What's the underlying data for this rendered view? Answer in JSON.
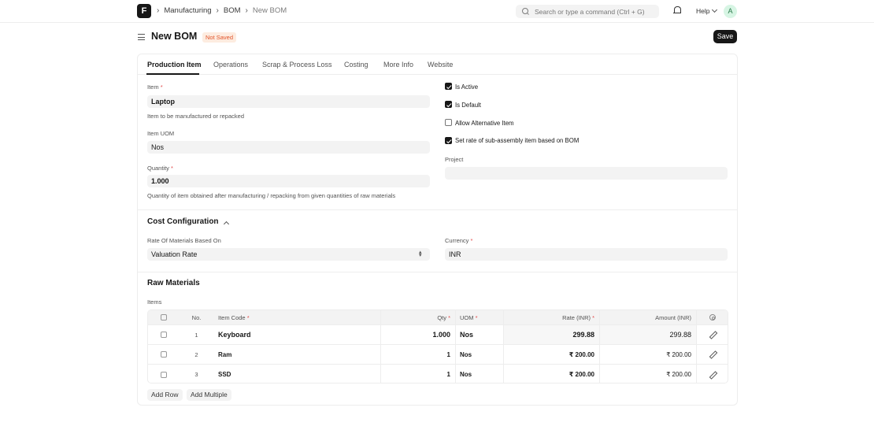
{
  "navbar": {
    "logo_letter": "F",
    "breadcrumbs": [
      "Manufacturing",
      "BOM",
      "New BOM"
    ],
    "search_placeholder": "Search or type a command (Ctrl + G)",
    "help_label": "Help",
    "avatar_letter": "A"
  },
  "header": {
    "title": "New BOM",
    "status_badge": "Not Saved",
    "save_label": "Save"
  },
  "tabs": [
    "Production Item",
    "Operations",
    "Scrap & Process Loss",
    "Costing",
    "More Info",
    "Website"
  ],
  "production": {
    "item_label": "Item",
    "item_value": "Laptop",
    "item_help": "Item to be manufactured or repacked",
    "uom_label": "Item UOM",
    "uom_value": "Nos",
    "qty_label": "Quantity",
    "qty_value": "1.000",
    "qty_help": "Quantity of item obtained after manufacturing / repacking from given quantities of raw materials",
    "checkboxes": [
      {
        "label": "Is Active",
        "checked": true
      },
      {
        "label": "Is Default",
        "checked": true
      },
      {
        "label": "Allow Alternative Item",
        "checked": false
      },
      {
        "label": "Set rate of sub-assembly item based on BOM",
        "checked": true
      }
    ],
    "project_label": "Project",
    "project_value": ""
  },
  "cost_config": {
    "title": "Cost Configuration",
    "rate_label": "Rate Of Materials Based On",
    "rate_value": "Valuation Rate",
    "currency_label": "Currency",
    "currency_value": "INR"
  },
  "raw_materials": {
    "title": "Raw Materials",
    "items_label": "Items",
    "columns": {
      "no": "No.",
      "item_code": "Item Code",
      "qty": "Qty",
      "uom": "UOM",
      "rate": "Rate (INR)",
      "amount": "Amount (INR)"
    },
    "rows": [
      {
        "no": "1",
        "item_code": "Keyboard",
        "qty": "1.000",
        "uom": "Nos",
        "rate": "299.88",
        "amount": "299.88"
      },
      {
        "no": "2",
        "item_code": "Ram",
        "qty": "1",
        "uom": "Nos",
        "rate": "₹ 200.00",
        "amount": "₹ 200.00"
      },
      {
        "no": "3",
        "item_code": "SSD",
        "qty": "1",
        "uom": "Nos",
        "rate": "₹ 200.00",
        "amount": "₹ 200.00"
      }
    ],
    "add_row_label": "Add Row",
    "add_multiple_label": "Add Multiple"
  },
  "required_marker": "*"
}
